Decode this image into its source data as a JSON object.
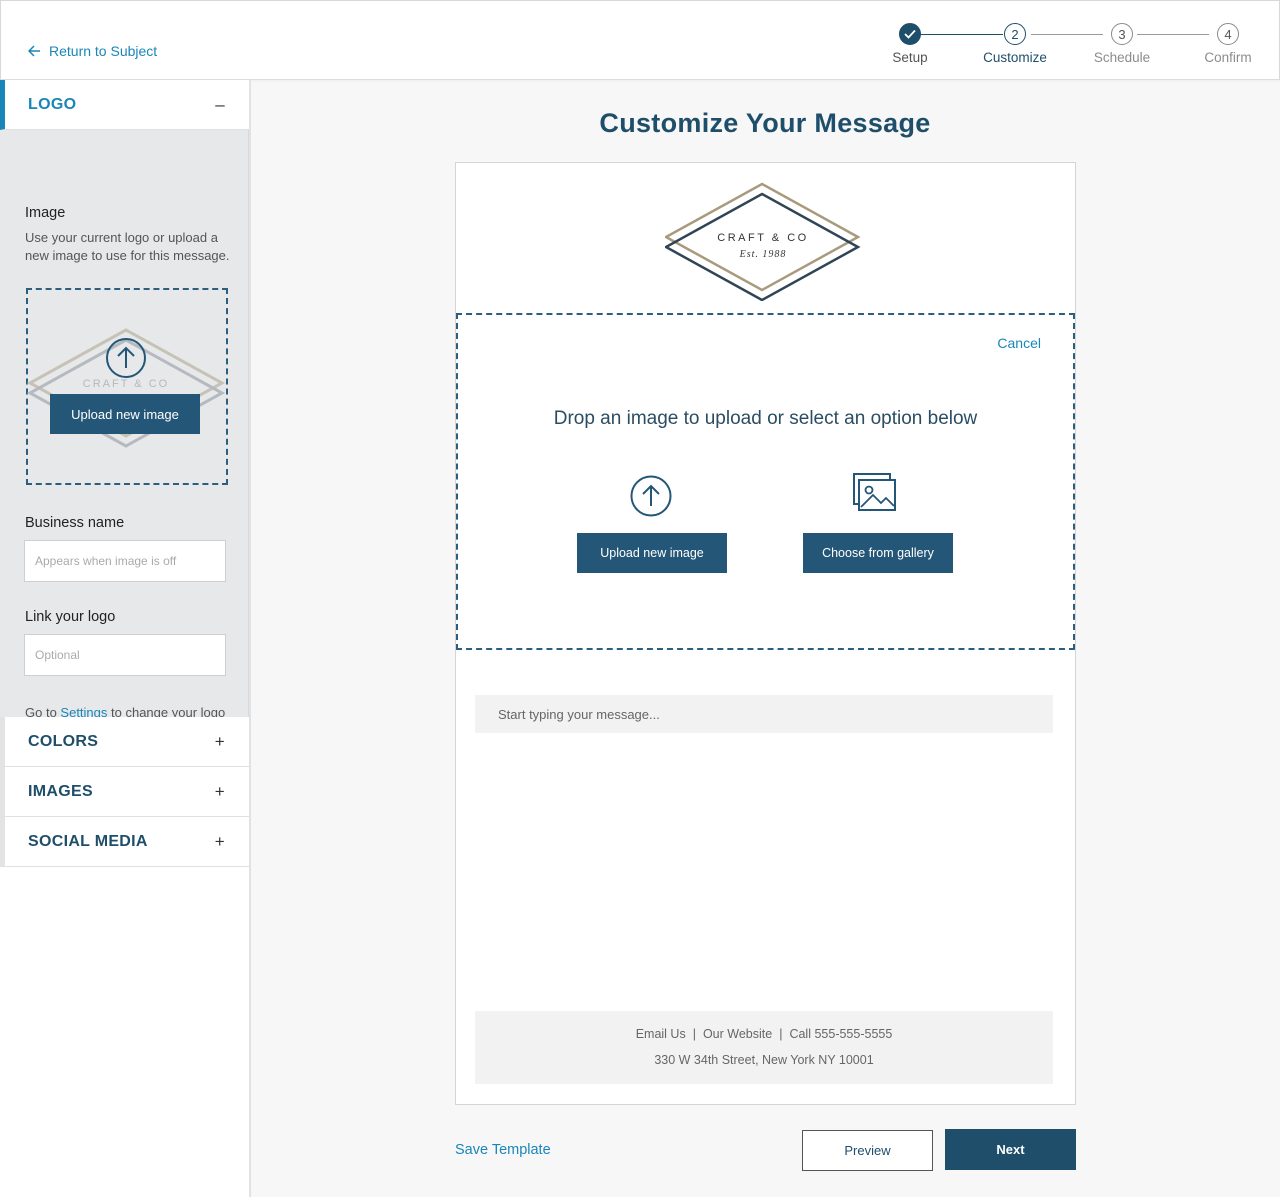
{
  "header": {
    "back_label": "Return to Subject",
    "steps": [
      {
        "number": "",
        "label": "Setup",
        "state": "done"
      },
      {
        "number": "2",
        "label": "Customize",
        "state": "active"
      },
      {
        "number": "3",
        "label": "Schedule",
        "state": "pending"
      },
      {
        "number": "4",
        "label": "Confirm",
        "state": "pending"
      }
    ]
  },
  "sidebar": {
    "logo_section": {
      "title": "LOGO",
      "toggle": "–",
      "image_label": "Image",
      "image_help": "Use your current logo or upload a new image to use for this message.",
      "upload_button": "Upload new image",
      "preview_logo_text": "CRAFT & CO",
      "business_name_label": "Business name",
      "business_name_placeholder": "Appears when image is off",
      "link_label": "Link your logo",
      "link_placeholder": "Optional",
      "settings_prefix": "Go to ",
      "settings_link": "Settings",
      "settings_suffix": " to change your logo across all templates."
    },
    "sections": [
      {
        "title": "COLORS",
        "toggle": "+"
      },
      {
        "title": "IMAGES",
        "toggle": "+"
      },
      {
        "title": "SOCIAL MEDIA",
        "toggle": "+"
      }
    ]
  },
  "main": {
    "title": "Customize Your Message",
    "logo": {
      "name": "CRAFT & CO",
      "tagline": "Est. 1988"
    },
    "drop_zone": {
      "cancel": "Cancel",
      "prompt": "Drop an image to upload or select an option below",
      "upload_button": "Upload new image",
      "gallery_button": "Choose from gallery"
    },
    "message_placeholder": "Start typing your message...",
    "footer": {
      "email": "Email Us",
      "website": "Our Website",
      "phone": "Call 555-555-5555",
      "divider": "|",
      "address": "330 W 34th Street, New York NY 10001"
    },
    "save_template": "Save Template",
    "preview": "Preview",
    "next": "Next"
  },
  "colors": {
    "primary_navy": "#1f4e6b",
    "button_blue": "#245677",
    "link_blue": "#1a86b8",
    "logo_tan": "#a89a7c"
  }
}
